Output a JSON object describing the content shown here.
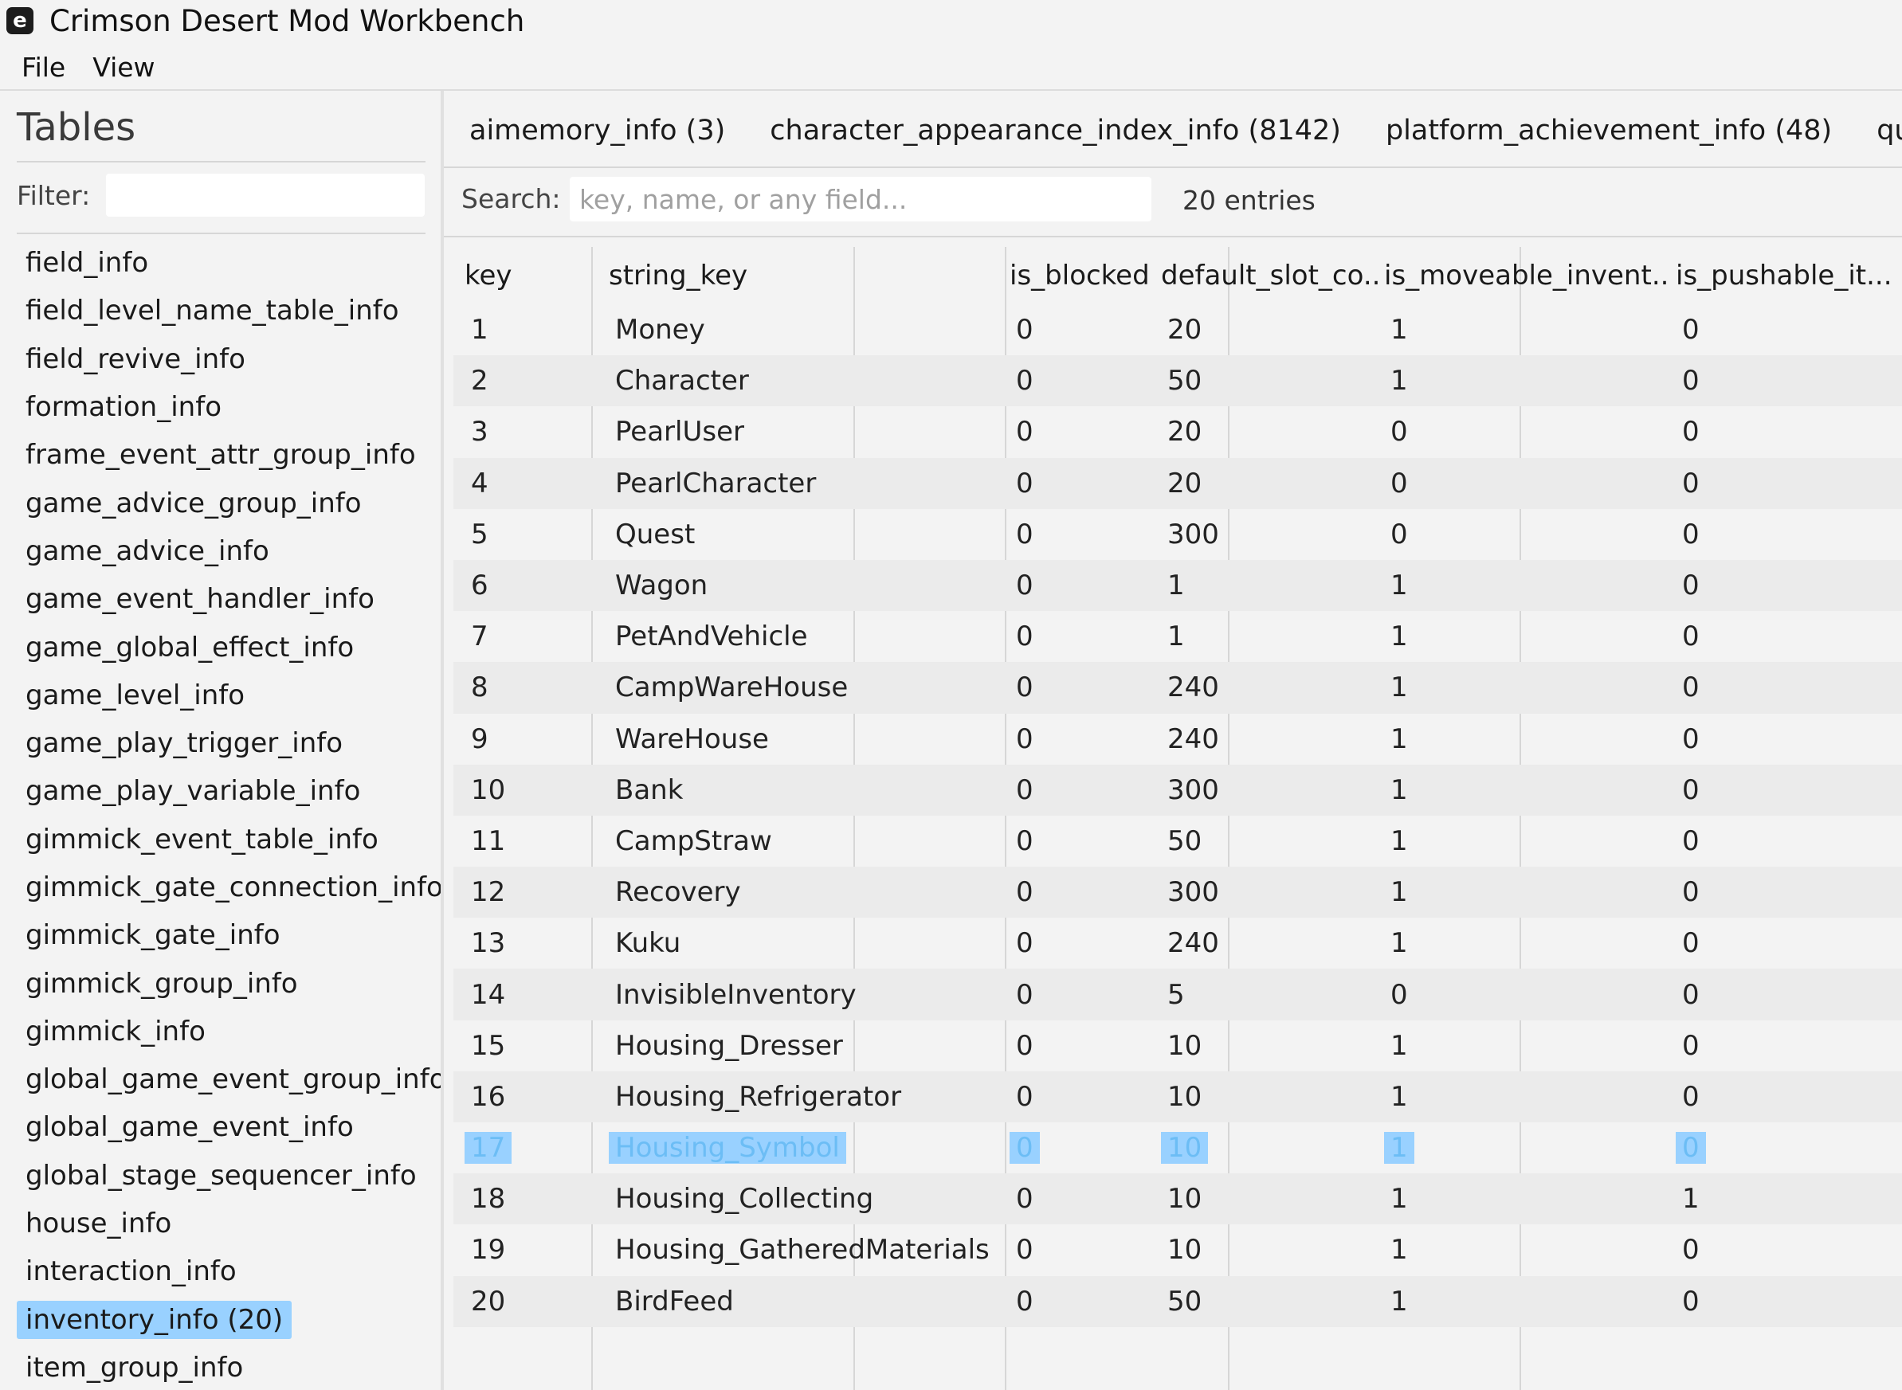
{
  "window": {
    "title": "Crimson Desert Mod Workbench",
    "icon_glyph": "e"
  },
  "menu": [
    "File",
    "View"
  ],
  "sidebar": {
    "title": "Tables",
    "filter_label": "Filter:",
    "filter_value": "",
    "items": [
      "field_info",
      "field_level_name_table_info",
      "field_revive_info",
      "formation_info",
      "frame_event_attr_group_info",
      "game_advice_group_info",
      "game_advice_info",
      "game_event_handler_info",
      "game_global_effect_info",
      "game_level_info",
      "game_play_trigger_info",
      "game_play_variable_info",
      "gimmick_event_table_info",
      "gimmick_gate_connection_info",
      "gimmick_gate_info",
      "gimmick_group_info",
      "gimmick_info",
      "global_game_event_group_info",
      "global_game_event_info",
      "global_stage_sequencer_info",
      "house_info",
      "interaction_info",
      "inventory_info (20)",
      "item_group_info"
    ],
    "selected_index": 22
  },
  "tabs": [
    "aimemory_info (3)",
    "character_appearance_index_info (8142)",
    "platform_achievement_info (48)",
    "quest_group_"
  ],
  "search": {
    "label": "Search:",
    "placeholder": "key, name, or any field...",
    "entries_text": "20 entries"
  },
  "table": {
    "columns": [
      "key",
      "string_key",
      "is_blocked",
      "default_slot_co...",
      "is_moveable_invent...",
      "is_pushable_it..."
    ],
    "rows": [
      [
        "1",
        "Money",
        "0",
        "20",
        "1",
        "0"
      ],
      [
        "2",
        "Character",
        "0",
        "50",
        "1",
        "0"
      ],
      [
        "3",
        "PearlUser",
        "0",
        "20",
        "0",
        "0"
      ],
      [
        "4",
        "PearlCharacter",
        "0",
        "20",
        "0",
        "0"
      ],
      [
        "5",
        "Quest",
        "0",
        "300",
        "0",
        "0"
      ],
      [
        "6",
        "Wagon",
        "0",
        "1",
        "1",
        "0"
      ],
      [
        "7",
        "PetAndVehicle",
        "0",
        "1",
        "1",
        "0"
      ],
      [
        "8",
        "CampWareHouse",
        "0",
        "240",
        "1",
        "0"
      ],
      [
        "9",
        "WareHouse",
        "0",
        "240",
        "1",
        "0"
      ],
      [
        "10",
        "Bank",
        "0",
        "300",
        "1",
        "0"
      ],
      [
        "11",
        "CampStraw",
        "0",
        "50",
        "1",
        "0"
      ],
      [
        "12",
        "Recovery",
        "0",
        "300",
        "1",
        "0"
      ],
      [
        "13",
        "Kuku",
        "0",
        "240",
        "1",
        "0"
      ],
      [
        "14",
        "InvisibleInventory",
        "0",
        "5",
        "0",
        "0"
      ],
      [
        "15",
        "Housing_Dresser",
        "0",
        "10",
        "1",
        "0"
      ],
      [
        "16",
        "Housing_Refrigerator",
        "0",
        "10",
        "1",
        "0"
      ],
      [
        "17",
        "Housing_Symbol",
        "0",
        "10",
        "1",
        "0"
      ],
      [
        "18",
        "Housing_Collecting",
        "0",
        "10",
        "1",
        "1"
      ],
      [
        "19",
        "Housing_GatheredMaterials",
        "0",
        "10",
        "1",
        "0"
      ],
      [
        "20",
        "BirdFeed",
        "0",
        "50",
        "1",
        "0"
      ]
    ],
    "selected_row": 16
  },
  "colors": {
    "selection": "#99d1ff",
    "background": "#f3f3f3",
    "row_alt": "#ebebeb"
  }
}
